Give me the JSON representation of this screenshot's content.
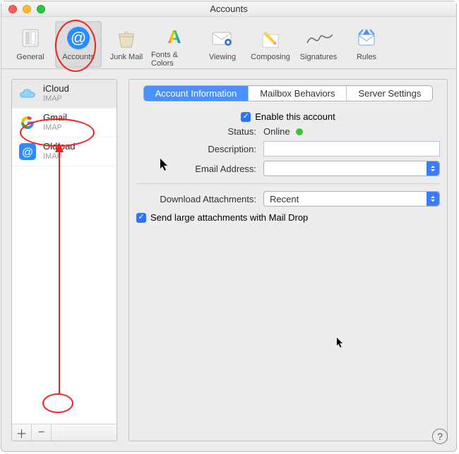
{
  "window": {
    "title": "Accounts"
  },
  "toolbar": {
    "items": [
      {
        "id": "general",
        "label": "General"
      },
      {
        "id": "accounts",
        "label": "Accounts"
      },
      {
        "id": "junk",
        "label": "Junk Mail"
      },
      {
        "id": "fonts",
        "label": "Fonts & Colors"
      },
      {
        "id": "viewing",
        "label": "Viewing"
      },
      {
        "id": "composing",
        "label": "Composing"
      },
      {
        "id": "signatures",
        "label": "Signatures"
      },
      {
        "id": "rules",
        "label": "Rules"
      }
    ]
  },
  "sidebar": {
    "accounts": [
      {
        "name": "iCloud",
        "protocol": "IMAP",
        "icon": "icloud"
      },
      {
        "name": "Gmail",
        "protocol": "IMAP",
        "icon": "google"
      },
      {
        "name": "Oldtoad",
        "protocol": "IMAP",
        "icon": "at"
      }
    ],
    "add_label": "＋",
    "remove_label": "−"
  },
  "tabs": {
    "items": [
      "Account Information",
      "Mailbox Behaviors",
      "Server Settings"
    ],
    "selected": 0
  },
  "form": {
    "enable_label": "Enable this account",
    "enable_checked": true,
    "status_label": "Status:",
    "status_value": "Online",
    "description_label": "Description:",
    "description_value": "",
    "email_label": "Email Address:",
    "email_value": "",
    "attachments_label": "Download Attachments:",
    "attachments_value": "Recent",
    "maildrop_label": "Send large attachments with Mail Drop",
    "maildrop_checked": true
  },
  "help_label": "?"
}
